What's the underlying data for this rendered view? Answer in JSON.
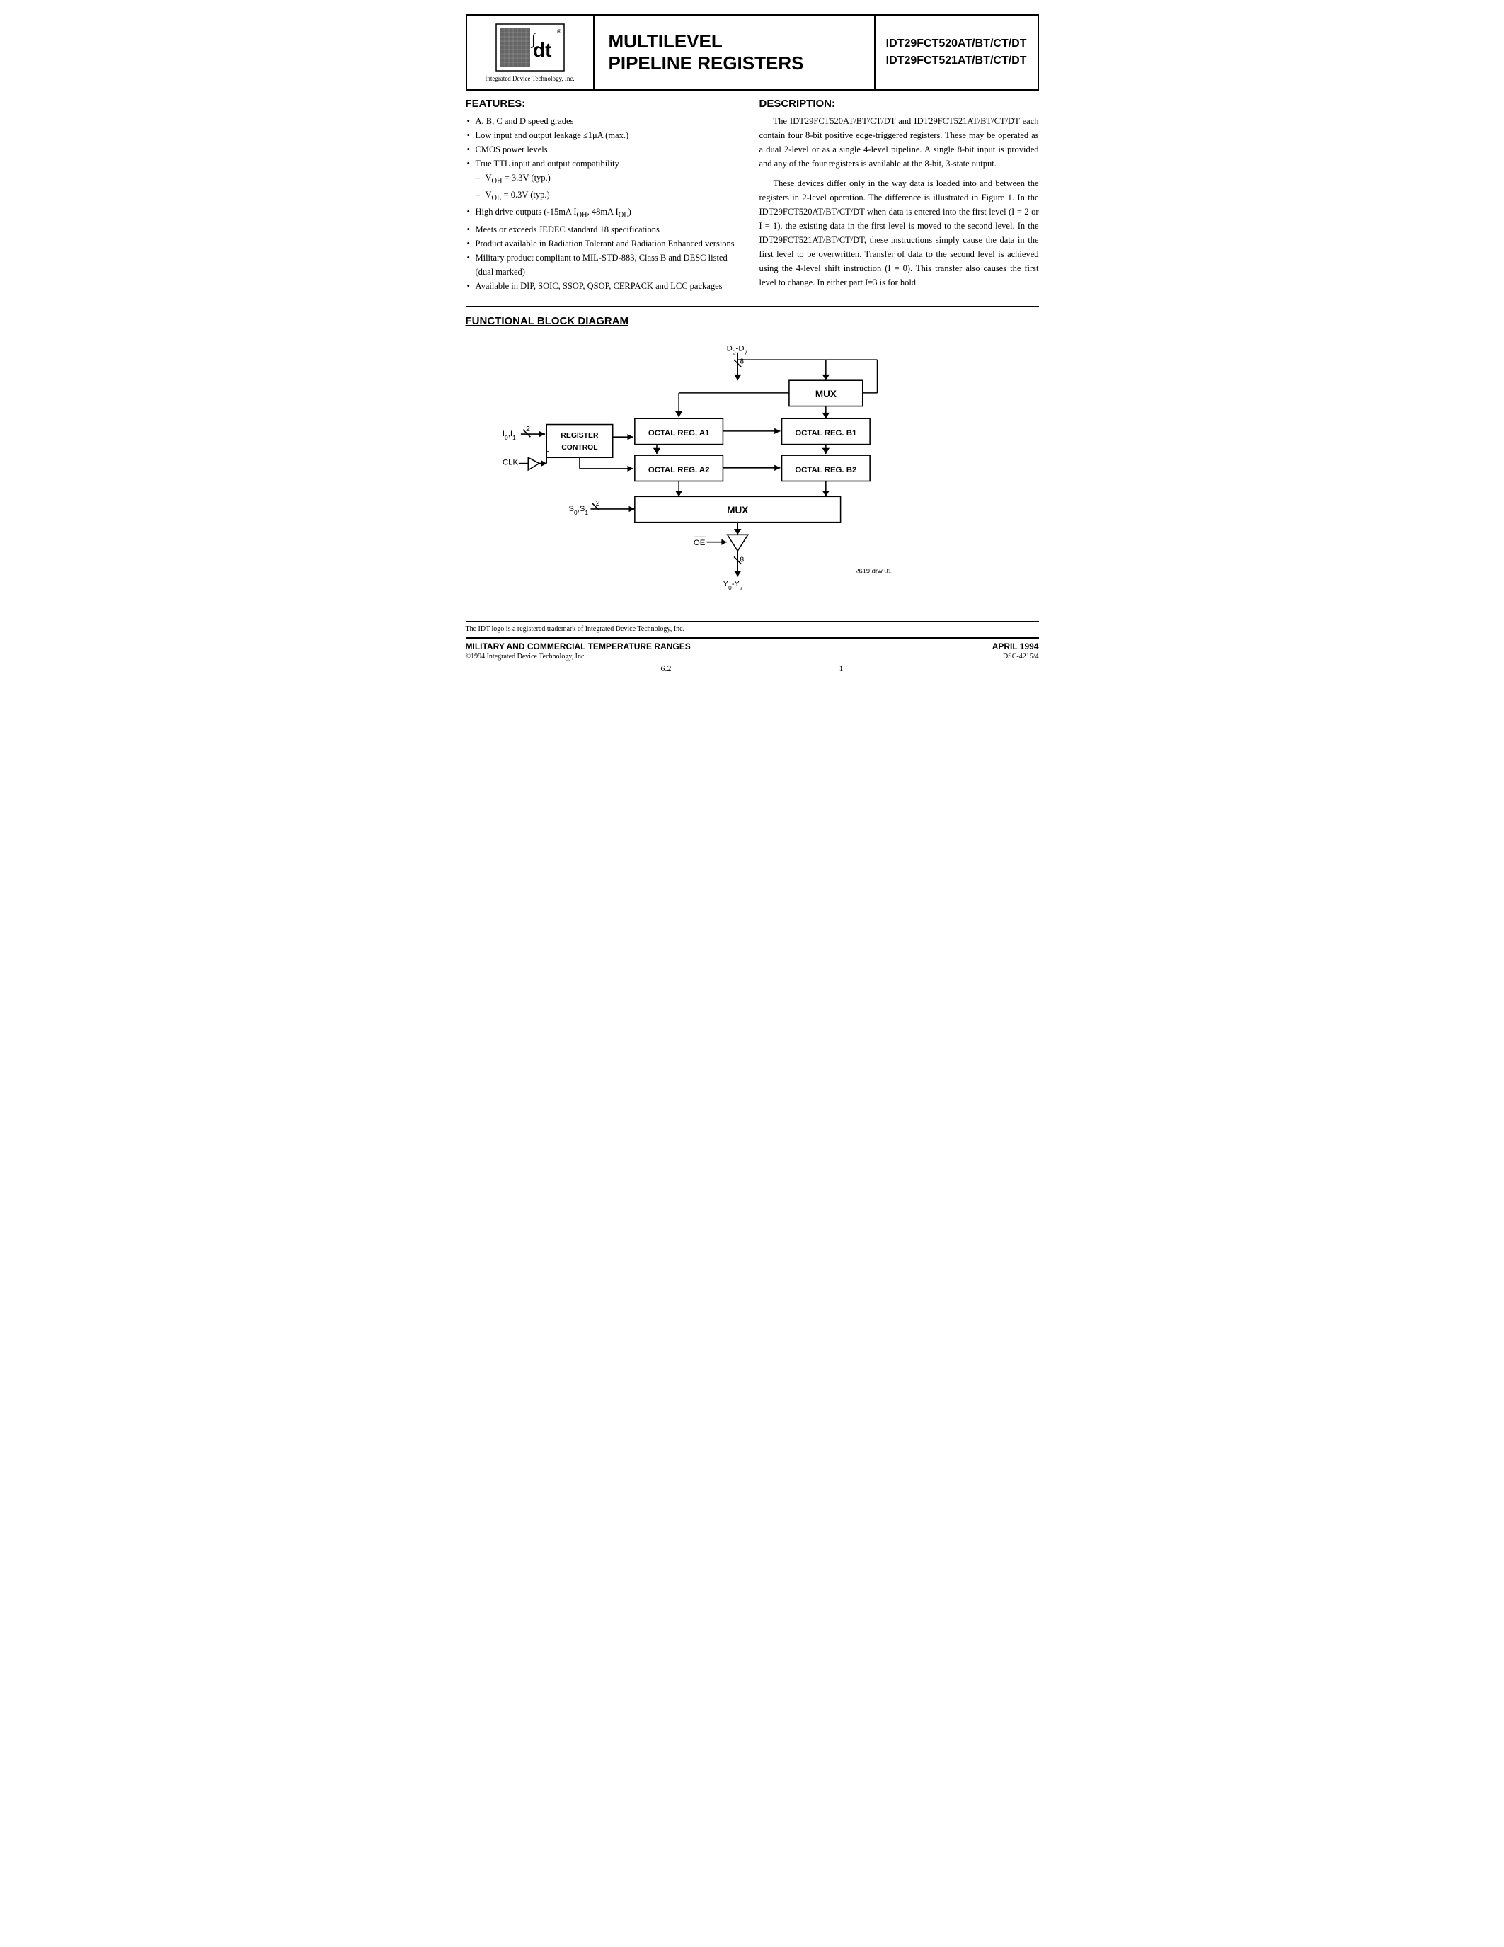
{
  "header": {
    "logo_company": "Integrated Device Technology, Inc.",
    "title_line1": "MULTILEVEL",
    "title_line2": "PIPELINE REGISTERS",
    "part_number1": "IDT29FCT520AT/BT/CT/DT",
    "part_number2": "IDT29FCT521AT/BT/CT/DT"
  },
  "features": {
    "heading": "FEATURES:",
    "items": [
      "A, B, C and D speed grades",
      "Low input and output leakage ≤1μA (max.)",
      "CMOS power levels",
      "True TTL input and output compatibility",
      "sub: – VOH = 3.3V (typ.)",
      "sub: – VOL = 0.3V (typ.)",
      "High drive outputs (-15mA IOH, 48mA IOL)",
      "Meets or exceeds JEDEC standard 18 specifications",
      "Product available in Radiation Tolerant and Radiation Enhanced versions",
      "Military product compliant to MIL-STD-883, Class B and DESC listed (dual marked)",
      "Available in DIP, SOIC, SSOP, QSOP, CERPACK and LCC packages"
    ]
  },
  "description": {
    "heading": "DESCRIPTION:",
    "paragraph1": "The IDT29FCT520AT/BT/CT/DT and IDT29FCT521AT/BT/CT/DT each contain four 8-bit positive edge-triggered registers. These may be operated as a dual 2-level or as a single 4-level pipeline. A single 8-bit input is provided and any of the four registers is available at the 8-bit, 3-state output.",
    "paragraph2": "These devices differ only in the way data is loaded into and between the registers in 2-level operation. The difference is illustrated in Figure 1. In the IDT29FCT520AT/BT/CT/DT when data is entered into the first level (I = 2 or I = 1), the existing data in the first level is moved to the second level. In the IDT29FCT521AT/BT/CT/DT, these instructions simply cause the data in the first level to be overwritten. Transfer of data to the second level is achieved using the 4-level shift instruction (I = 0). This transfer also causes the first level to change. In either part I=3 is for hold."
  },
  "functional_block_diagram": {
    "heading": "FUNCTIONAL BLOCK DIAGRAM",
    "blocks": {
      "mux_top": "MUX",
      "reg_a1": "OCTAL REG. A1",
      "reg_a2": "OCTAL REG. A2",
      "reg_b1": "OCTAL REG. B1",
      "reg_b2": "OCTAL REG. B2",
      "mux_bottom": "MUX",
      "register_control": "REGISTER CONTROL"
    },
    "signals": {
      "d_input": "D0 -D7",
      "clk": "CLK",
      "io": "I0 ,I1",
      "s_input": "S0 ,S1",
      "oe": "OE",
      "y_output": "Y0 -Y7",
      "bus_width_top": "8",
      "bus_width_bottom": "8",
      "io_width": "2",
      "s_width": "2",
      "drawing_num": "2619 drw 01"
    }
  },
  "footer": {
    "trademark": "The IDT logo is a registered trademark of Integrated Device Technology, Inc.",
    "mil_text": "MILITARY AND COMMERCIAL TEMPERATURE RANGES",
    "date": "APRIL 1994",
    "copyright": "©1994 Integrated Device Technology, Inc.",
    "page_num": "6.2",
    "doc_num": "DSC-4215/4",
    "page_index": "1"
  }
}
